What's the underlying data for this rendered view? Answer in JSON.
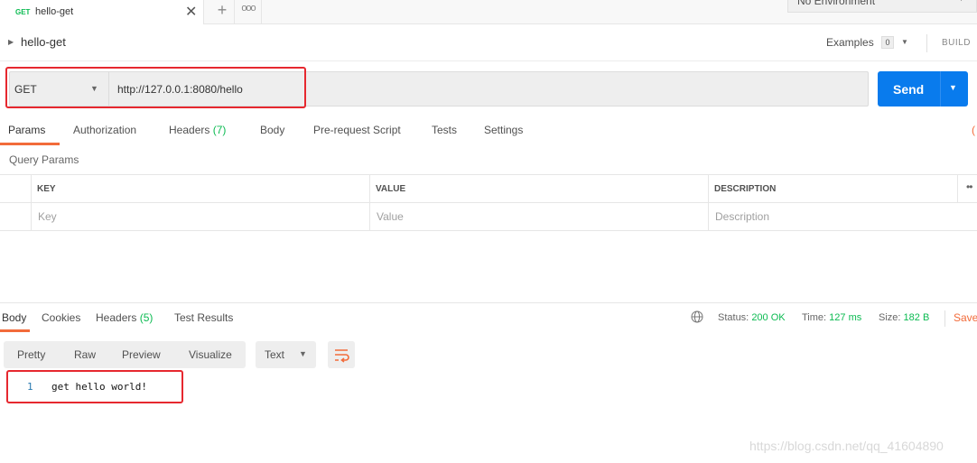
{
  "tab": {
    "method": "GET",
    "name": "hello-get",
    "close": "✕",
    "add": "+",
    "more": "ooo"
  },
  "environment": {
    "label": "No Environment"
  },
  "request_name": "hello-get",
  "examples": {
    "label": "Examples",
    "count": "0"
  },
  "build_label": "BUILD",
  "request": {
    "method": "GET",
    "url": "http://127.0.0.1:8080/hello",
    "send_label": "Send"
  },
  "request_tabs": [
    {
      "label": "Params",
      "count": ""
    },
    {
      "label": "Authorization",
      "count": ""
    },
    {
      "label": "Headers",
      "count": "(7)"
    },
    {
      "label": "Body",
      "count": ""
    },
    {
      "label": "Pre-request Script",
      "count": ""
    },
    {
      "label": "Tests",
      "count": ""
    },
    {
      "label": "Settings",
      "count": ""
    }
  ],
  "query_params": {
    "title": "Query Params",
    "columns": [
      "KEY",
      "VALUE",
      "DESCRIPTION"
    ],
    "placeholders": [
      "Key",
      "Value",
      "Description"
    ]
  },
  "response": {
    "tabs": [
      {
        "label": "Body",
        "count": ""
      },
      {
        "label": "Cookies",
        "count": ""
      },
      {
        "label": "Headers",
        "count": "(5)"
      },
      {
        "label": "Test Results",
        "count": ""
      }
    ],
    "status_label": "Status:",
    "status_value": "200 OK",
    "time_label": "Time:",
    "time_value": "127 ms",
    "size_label": "Size:",
    "size_value": "182 B",
    "save_label": "Save",
    "views": [
      "Pretty",
      "Raw",
      "Preview",
      "Visualize"
    ],
    "format": "Text",
    "lines": [
      {
        "number": "1",
        "text": "get hello world!"
      }
    ]
  },
  "watermark": "https://blog.csdn.net/qq_41604890",
  "colors": {
    "accent": "#f26b3a",
    "send": "#097bed",
    "success": "#0cbb52",
    "highlight": "#e6282f"
  }
}
